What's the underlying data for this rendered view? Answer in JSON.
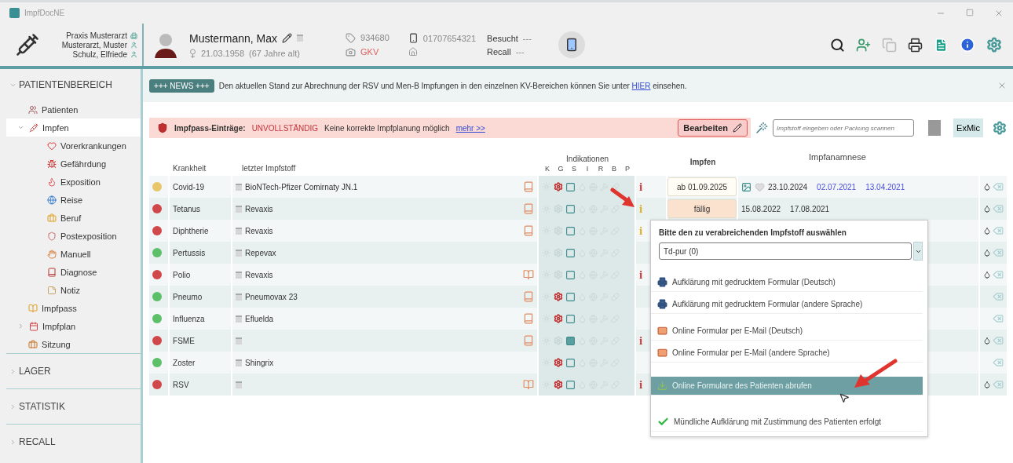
{
  "window": {
    "title": "ImpfDocNE"
  },
  "practice": {
    "lines": [
      "Praxis Musterarzt",
      "Musterarzt, Muster",
      "Schulz, Elfriede"
    ]
  },
  "patient": {
    "name": "Mustermann, Max",
    "birthdate": "21.03.1958",
    "age": "(67 Jahre alt)",
    "number": "934680",
    "insurance": "GKV",
    "phone": "01707654321",
    "visited_label": "Besucht",
    "visited_value": "---",
    "recall_label": "Recall",
    "recall_value": "---"
  },
  "sidebar": {
    "sections": [
      {
        "label": "PATIENTENBEREICH",
        "expanded": true,
        "items": [
          {
            "label": "Patienten",
            "selected": false
          },
          {
            "label": "Impfen",
            "selected": true,
            "expanded": true,
            "children": [
              {
                "label": "Vorerkrankungen",
                "selected": false
              },
              {
                "label": "Gefährdung",
                "selected": false
              },
              {
                "label": "Exposition",
                "selected": false
              },
              {
                "label": "Reise",
                "selected": false
              },
              {
                "label": "Beruf",
                "selected": false
              },
              {
                "label": "Postexposition",
                "selected": false
              },
              {
                "label": "Manuell",
                "selected": false
              },
              {
                "label": "Diagnose",
                "selected": false
              },
              {
                "label": "Notiz",
                "selected": false
              }
            ]
          },
          {
            "label": "Impfpass",
            "selected": false
          },
          {
            "label": "Impfplan",
            "selected": false,
            "expanded": false
          },
          {
            "label": "Sitzung",
            "selected": false
          }
        ]
      },
      {
        "label": "LAGER",
        "expanded": false
      },
      {
        "label": "STATISTIK",
        "expanded": false
      },
      {
        "label": "RECALL",
        "expanded": false
      }
    ]
  },
  "news": {
    "badge": "+++ NEWS +++",
    "text_before": "Den aktuellen Stand zur Abrechnung der RSV und Men-B Impfungen in den einzelnen KV-Bereichen können Sie unter",
    "link": "HIER",
    "text_after": "einsehen."
  },
  "alert": {
    "label": "Impfpass-Einträge:",
    "status": "UNVOLLSTÄNDIG",
    "message": "Keine korrekte Impfplanung möglich",
    "link": "mehr >>",
    "button": "Bearbeiten"
  },
  "vaccine_search": {
    "placeholder": "Impfstoff eingeben oder Packung scannen"
  },
  "exmic_button": "ExMic",
  "table": {
    "columns": {
      "disease": "Krankheit",
      "vaccine": "letzter Impfstoff",
      "indications": "Indikationen",
      "indication_letters": [
        "K",
        "G",
        "S",
        "I",
        "R",
        "B",
        "P"
      ],
      "vaccinate": "Impfen",
      "history": "Impfanamnese"
    },
    "rows": [
      {
        "color": "#e8c76a",
        "disease": "Covid-19",
        "vaccine": "BioNTech-Pfizer Comirnaty JN.1",
        "pass_shown": true,
        "pass_open": false,
        "hazard": true,
        "s_filled": false,
        "info": {
          "symbol": "i",
          "color": "#d03a3a"
        },
        "vaccinate": "ab 01.09.2025",
        "vaccinate_due": false,
        "history_icons": true,
        "history": [
          {
            "date": "23.10.2024",
            "linked": false
          },
          {
            "date": "02.07.2021",
            "linked": true
          },
          {
            "date": "13.04.2021",
            "linked": true
          }
        ],
        "drop": true
      },
      {
        "color": "#d0484b",
        "disease": "Tetanus",
        "vaccine": "Revaxis",
        "pass_shown": true,
        "pass_open": false,
        "hazard": false,
        "s_filled": false,
        "info": {
          "symbol": "i",
          "color": "#e0b020"
        },
        "vaccinate": "fällig",
        "vaccinate_due": true,
        "history": [
          {
            "date": "15.08.2022",
            "linked": false
          },
          {
            "date": "17.08.2021",
            "linked": false
          }
        ],
        "drop": true
      },
      {
        "color": "#d0484b",
        "disease": "Diphtherie",
        "vaccine": "Revaxis",
        "pass_shown": true,
        "pass_open": false,
        "hazard": false,
        "s_filled": false,
        "info": {
          "symbol": "i",
          "color": "#e0b020"
        },
        "drop": true
      },
      {
        "color": "#5cbf6a",
        "disease": "Pertussis",
        "vaccine": "Repevax",
        "pass_shown": false,
        "hazard": false,
        "s_filled": false,
        "drop": true
      },
      {
        "color": "#d0484b",
        "disease": "Polio",
        "vaccine": "Revaxis",
        "pass_shown": true,
        "pass_open": true,
        "hazard": false,
        "s_filled": false,
        "info": {
          "symbol": "i",
          "color": "#d03a3a"
        },
        "drop": true
      },
      {
        "color": "#5cbf6a",
        "disease": "Pneumo",
        "vaccine": "Pneumovax 23",
        "pass_shown": true,
        "pass_open": false,
        "hazard": true,
        "s_filled": false,
        "drop": false
      },
      {
        "color": "#5cbf6a",
        "disease": "Influenza",
        "vaccine": "Efluelda",
        "pass_shown": true,
        "pass_open": false,
        "hazard": true,
        "s_filled": false,
        "drop": false
      },
      {
        "color": "#d0484b",
        "disease": "FSME",
        "vaccine": "",
        "pass_shown": true,
        "pass_open": false,
        "hazard": false,
        "s_filled": true,
        "info": {
          "symbol": "i",
          "color": "#d03a3a"
        },
        "drop": true
      },
      {
        "color": "#5cbf6a",
        "disease": "Zoster",
        "vaccine": "Shingrix",
        "pass_shown": false,
        "hazard": true,
        "s_filled": false,
        "drop": false
      },
      {
        "color": "#d0484b",
        "disease": "RSV",
        "vaccine": "",
        "pass_shown": true,
        "pass_open": true,
        "hazard": true,
        "s_filled": false,
        "info": {
          "symbol": "i",
          "color": "#d03a3a"
        },
        "drop": true
      }
    ]
  },
  "popup": {
    "title": "Bitte den zu verabreichenden Impfstoff auswählen",
    "select_value": "Td-pur (0)",
    "options": [
      {
        "kind": "print",
        "label": "Aufklärung mit gedrucktem Formular (Deutsch)",
        "selected": false
      },
      {
        "kind": "print",
        "label": "Aufklärung mit gedrucktem Formular (andere Sprache)",
        "selected": false
      },
      {
        "kind": "mail",
        "label": "Online Formular per E-Mail (Deutsch)",
        "selected": false
      },
      {
        "kind": "mail",
        "label": "Online Formular per E-Mail (andere Sprache)",
        "selected": false
      },
      {
        "kind": "fetch",
        "label": "Online Formulare des Patienten abrufen",
        "selected": true
      },
      {
        "kind": "check",
        "label": "Mündliche Aufklärung mit Zustimmung des Patienten erfolgt",
        "selected": false
      }
    ]
  }
}
